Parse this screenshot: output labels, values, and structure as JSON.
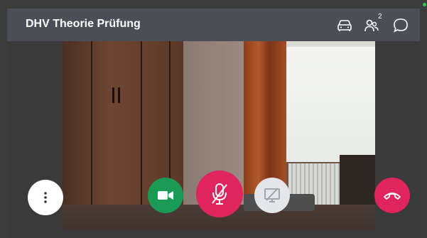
{
  "header": {
    "title": "DHV Theorie Prüfung",
    "participants_count": "2"
  },
  "icons": {
    "car": "car-icon",
    "participants": "participants-icon",
    "chat": "chat-bubble-icon",
    "more": "more-vertical-icon",
    "camera": "video-camera-icon",
    "microphone_muted": "microphone-off-icon",
    "screen_share_off": "screen-share-off-icon",
    "hang_up": "phone-hangup-icon"
  },
  "colors": {
    "header_bg": "#4b4e55",
    "camera_button": "#1a9a55",
    "mute_button": "#e0245e",
    "hangup_button": "#e0245e",
    "share_button": "#e5e6ea",
    "status_dot": "#2ac94a"
  }
}
